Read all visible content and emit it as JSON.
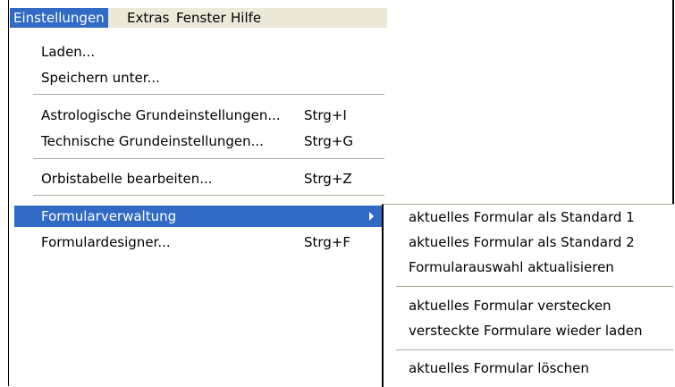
{
  "menubar": {
    "items": [
      {
        "label": "Einstellungen"
      },
      {
        "label": "Extras"
      },
      {
        "label": "Fenster"
      },
      {
        "label": "Hilfe"
      }
    ]
  },
  "menu": {
    "items": [
      {
        "label": "Laden..."
      },
      {
        "label": "Speichern unter..."
      },
      {
        "label": "Astrologische Grundeinstellungen...",
        "shortcut": "Strg+I"
      },
      {
        "label": "Technische Grundeinstellungen...",
        "shortcut": "Strg+G"
      },
      {
        "label": "Orbistabelle bearbeiten...",
        "shortcut": "Strg+Z"
      },
      {
        "label": "Formularverwaltung"
      },
      {
        "label": "Formulardesigner...",
        "shortcut": "Strg+F"
      }
    ]
  },
  "submenu": {
    "items": [
      {
        "label": "aktuelles Formular als Standard 1"
      },
      {
        "label": "aktuelles Formular als Standard 2"
      },
      {
        "label": "Formularauswahl aktualisieren"
      },
      {
        "label": "aktuelles Formular verstecken"
      },
      {
        "label": "versteckte Formulare wieder laden"
      },
      {
        "label": "aktuelles Formular löschen"
      }
    ]
  },
  "colors": {
    "highlight": "#316ac5",
    "menubar_bg": "#ece9d8",
    "separator": "#aca899"
  },
  "icons": {
    "submenu_arrow": "chevron-right-icon"
  }
}
